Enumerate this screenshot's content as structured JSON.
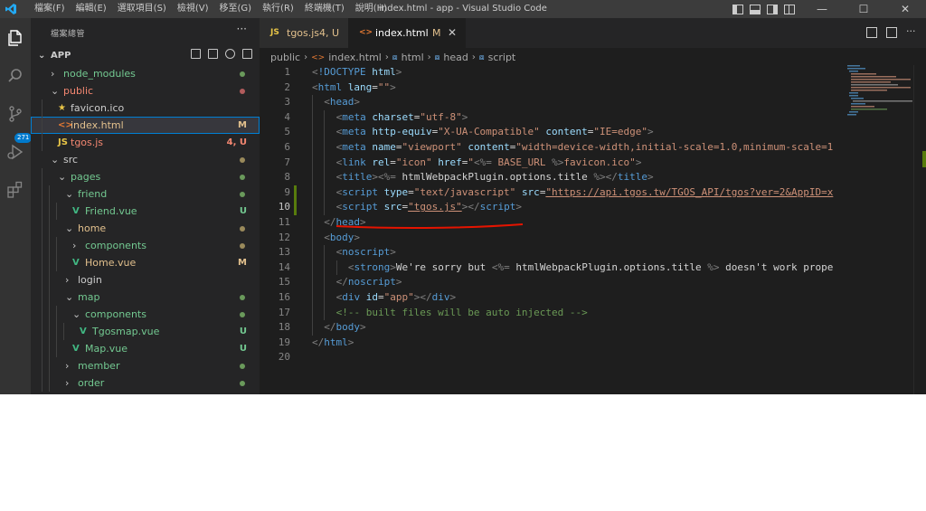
{
  "titlebar": {
    "menus": [
      "檔案(F)",
      "編輯(E)",
      "選取項目(S)",
      "檢視(V)",
      "移至(G)",
      "執行(R)",
      "終端機(T)",
      "說明(H)"
    ],
    "title": "index.html - app - Visual Studio Code",
    "minimize": "—",
    "maximize": "☐",
    "close": "✕"
  },
  "activity": {
    "badge": "271"
  },
  "sidebar": {
    "title": "檔案總管",
    "more": "···",
    "root": "APP",
    "rows": [
      {
        "depth": 0,
        "chev": "›",
        "name": "node_modules",
        "color": "#73c991",
        "status": "dot",
        "statusColor": "#6a9a5b"
      },
      {
        "depth": 0,
        "chev": "⌄",
        "name": "public",
        "color": "#f48771",
        "status": "dot",
        "statusColor": "#b25c5c"
      },
      {
        "depth": 1,
        "icon": "★",
        "iconColor": "#e8c547",
        "name": "favicon.ico",
        "color": "#cccccc",
        "status": "",
        "statusColor": ""
      },
      {
        "depth": 1,
        "icon": "<>",
        "iconColor": "#e37933",
        "name": "index.html",
        "color": "#e2c08d",
        "status": "M",
        "statusColor": "#e2c08d",
        "selected": true
      },
      {
        "depth": 1,
        "icon": "JS",
        "iconColor": "#e8c547",
        "name": "tgos.js",
        "color": "#f48771",
        "status": "4, U",
        "statusColor": "#f48771"
      },
      {
        "depth": 0,
        "chev": "⌄",
        "name": "src",
        "color": "#cccccc",
        "status": "dot",
        "statusColor": "#9a8a5b"
      },
      {
        "depth": 1,
        "chev": "⌄",
        "name": "pages",
        "color": "#73c991",
        "status": "dot",
        "statusColor": "#6a9a5b"
      },
      {
        "depth": 2,
        "chev": "⌄",
        "name": "friend",
        "color": "#73c991",
        "status": "dot",
        "statusColor": "#6a9a5b"
      },
      {
        "depth": 3,
        "icon": "V",
        "iconColor": "#41b883",
        "name": "Friend.vue",
        "color": "#73c991",
        "status": "U",
        "statusColor": "#73c991"
      },
      {
        "depth": 2,
        "chev": "⌄",
        "name": "home",
        "color": "#e2c08d",
        "status": "dot",
        "statusColor": "#9a8a5b"
      },
      {
        "depth": 3,
        "chev": "›",
        "name": "components",
        "color": "#73c991",
        "status": "dot",
        "statusColor": "#9a8a5b"
      },
      {
        "depth": 3,
        "icon": "V",
        "iconColor": "#41b883",
        "name": "Home.vue",
        "color": "#e2c08d",
        "status": "M",
        "statusColor": "#e2c08d"
      },
      {
        "depth": 2,
        "chev": "›",
        "name": "login",
        "color": "#cccccc",
        "status": "",
        "statusColor": ""
      },
      {
        "depth": 2,
        "chev": "⌄",
        "name": "map",
        "color": "#73c991",
        "status": "dot",
        "statusColor": "#6a9a5b"
      },
      {
        "depth": 3,
        "chev": "⌄",
        "name": "components",
        "color": "#73c991",
        "status": "dot",
        "statusColor": "#6a9a5b"
      },
      {
        "depth": 4,
        "icon": "V",
        "iconColor": "#41b883",
        "name": "Tgosmap.vue",
        "color": "#73c991",
        "status": "U",
        "statusColor": "#73c991"
      },
      {
        "depth": 3,
        "icon": "V",
        "iconColor": "#41b883",
        "name": "Map.vue",
        "color": "#73c991",
        "status": "U",
        "statusColor": "#73c991"
      },
      {
        "depth": 2,
        "chev": "›",
        "name": "member",
        "color": "#73c991",
        "status": "dot",
        "statusColor": "#6a9a5b"
      },
      {
        "depth": 2,
        "chev": "›",
        "name": "order",
        "color": "#73c991",
        "status": "dot",
        "statusColor": "#6a9a5b"
      }
    ]
  },
  "tabs": [
    {
      "icon": "JS",
      "name": "tgos.js",
      "modifier": "4, U",
      "close": "",
      "active": false
    },
    {
      "icon": "<>",
      "name": "index.html",
      "modifier": "M",
      "close": "✕",
      "active": true
    }
  ],
  "breadcrumb": [
    "public",
    "index.html",
    "html",
    "head",
    "script"
  ],
  "code": {
    "lines": [
      {
        "n": "1",
        "indent": 0,
        "tokens": [
          [
            "p",
            "<"
          ],
          [
            "t",
            "!DOCTYPE"
          ],
          [
            "x",
            " "
          ],
          [
            "a",
            "html"
          ],
          [
            "p",
            ">"
          ]
        ]
      },
      {
        "n": "2",
        "indent": 0,
        "tokens": [
          [
            "p",
            "<"
          ],
          [
            "t",
            "html"
          ],
          [
            "x",
            " "
          ],
          [
            "a",
            "lang"
          ],
          [
            "x",
            "="
          ],
          [
            "s",
            "\"\""
          ],
          [
            "p",
            ">"
          ]
        ]
      },
      {
        "n": "3",
        "indent": 1,
        "tokens": [
          [
            "p",
            "<"
          ],
          [
            "t",
            "head"
          ],
          [
            "p",
            ">"
          ]
        ]
      },
      {
        "n": "4",
        "indent": 2,
        "tokens": [
          [
            "p",
            "<"
          ],
          [
            "t",
            "meta"
          ],
          [
            "x",
            " "
          ],
          [
            "a",
            "charset"
          ],
          [
            "x",
            "="
          ],
          [
            "s",
            "\"utf-8\""
          ],
          [
            "p",
            ">"
          ]
        ]
      },
      {
        "n": "5",
        "indent": 2,
        "tokens": [
          [
            "p",
            "<"
          ],
          [
            "t",
            "meta"
          ],
          [
            "x",
            " "
          ],
          [
            "a",
            "http-equiv"
          ],
          [
            "x",
            "="
          ],
          [
            "s",
            "\"X-UA-Compatible\""
          ],
          [
            "x",
            " "
          ],
          [
            "a",
            "content"
          ],
          [
            "x",
            "="
          ],
          [
            "s",
            "\"IE=edge\""
          ],
          [
            "p",
            ">"
          ]
        ]
      },
      {
        "n": "6",
        "indent": 2,
        "tokens": [
          [
            "p",
            "<"
          ],
          [
            "t",
            "meta"
          ],
          [
            "x",
            " "
          ],
          [
            "a",
            "name"
          ],
          [
            "x",
            "="
          ],
          [
            "s",
            "\"viewport\""
          ],
          [
            "x",
            " "
          ],
          [
            "a",
            "content"
          ],
          [
            "x",
            "="
          ],
          [
            "s",
            "\"width=device-width,initial-scale=1.0,minimum-scale=1"
          ]
        ]
      },
      {
        "n": "7",
        "indent": 2,
        "tokens": [
          [
            "p",
            "<"
          ],
          [
            "t",
            "link"
          ],
          [
            "x",
            " "
          ],
          [
            "a",
            "rel"
          ],
          [
            "x",
            "="
          ],
          [
            "s",
            "\"icon\""
          ],
          [
            "x",
            " "
          ],
          [
            "a",
            "href"
          ],
          [
            "x",
            "="
          ],
          [
            "s",
            "\""
          ],
          [
            "p",
            "<%="
          ],
          [
            "s",
            " BASE_URL "
          ],
          [
            "p",
            "%>"
          ],
          [
            "s",
            "favicon.ico\""
          ],
          [
            "p",
            ">"
          ]
        ]
      },
      {
        "n": "8",
        "indent": 2,
        "tokens": [
          [
            "p",
            "<"
          ],
          [
            "t",
            "title"
          ],
          [
            "p",
            ">"
          ],
          [
            "p",
            "<%="
          ],
          [
            "x",
            " htmlWebpackPlugin.options.title "
          ],
          [
            "p",
            "%>"
          ],
          [
            "p",
            "</"
          ],
          [
            "t",
            "title"
          ],
          [
            "p",
            ">"
          ]
        ]
      },
      {
        "n": "9",
        "indent": 2,
        "gutter": true,
        "tokens": [
          [
            "p",
            "<"
          ],
          [
            "t",
            "script"
          ],
          [
            "x",
            " "
          ],
          [
            "a",
            "type"
          ],
          [
            "x",
            "="
          ],
          [
            "s",
            "\"text/javascript\""
          ],
          [
            "x",
            " "
          ],
          [
            "a",
            "src"
          ],
          [
            "x",
            "="
          ],
          [
            "su",
            "\"https://api.tgos.tw/TGOS_API/tgos?ver=2&AppID=x"
          ]
        ]
      },
      {
        "n": "10",
        "indent": 2,
        "gutter": true,
        "current": true,
        "tokens": [
          [
            "p",
            "<"
          ],
          [
            "t",
            "script"
          ],
          [
            "x",
            " "
          ],
          [
            "a",
            "src"
          ],
          [
            "x",
            "="
          ],
          [
            "su",
            "\"tgos.js\""
          ],
          [
            "p",
            ">"
          ],
          [
            "p",
            "</"
          ],
          [
            "t",
            "script"
          ],
          [
            "p",
            ">"
          ]
        ]
      },
      {
        "n": "11",
        "indent": 1,
        "tokens": [
          [
            "p",
            "</"
          ],
          [
            "t",
            "head"
          ],
          [
            "p",
            ">"
          ]
        ]
      },
      {
        "n": "12",
        "indent": 1,
        "tokens": [
          [
            "p",
            "<"
          ],
          [
            "t",
            "body"
          ],
          [
            "p",
            ">"
          ]
        ]
      },
      {
        "n": "13",
        "indent": 2,
        "tokens": [
          [
            "p",
            "<"
          ],
          [
            "t",
            "noscript"
          ],
          [
            "p",
            ">"
          ]
        ]
      },
      {
        "n": "14",
        "indent": 3,
        "tokens": [
          [
            "p",
            "<"
          ],
          [
            "t",
            "strong"
          ],
          [
            "p",
            ">"
          ],
          [
            "x",
            "We're sorry but "
          ],
          [
            "p",
            "<%="
          ],
          [
            "x",
            " htmlWebpackPlugin.options.title "
          ],
          [
            "p",
            "%>"
          ],
          [
            "x",
            " doesn't work prope"
          ]
        ]
      },
      {
        "n": "15",
        "indent": 2,
        "tokens": [
          [
            "p",
            "</"
          ],
          [
            "t",
            "noscript"
          ],
          [
            "p",
            ">"
          ]
        ]
      },
      {
        "n": "16",
        "indent": 2,
        "tokens": [
          [
            "p",
            "<"
          ],
          [
            "t",
            "div"
          ],
          [
            "x",
            " "
          ],
          [
            "a",
            "id"
          ],
          [
            "x",
            "="
          ],
          [
            "s",
            "\"app\""
          ],
          [
            "p",
            ">"
          ],
          [
            "p",
            "</"
          ],
          [
            "t",
            "div"
          ],
          [
            "p",
            ">"
          ]
        ]
      },
      {
        "n": "17",
        "indent": 2,
        "tokens": [
          [
            "c",
            "<!-- built files will be auto injected -->"
          ]
        ]
      },
      {
        "n": "18",
        "indent": 1,
        "tokens": [
          [
            "p",
            "</"
          ],
          [
            "t",
            "body"
          ],
          [
            "p",
            ">"
          ]
        ]
      },
      {
        "n": "19",
        "indent": 0,
        "tokens": [
          [
            "p",
            "</"
          ],
          [
            "t",
            "html"
          ],
          [
            "p",
            ">"
          ]
        ]
      },
      {
        "n": "20",
        "indent": 0,
        "tokens": []
      }
    ]
  },
  "colors": {
    "accent": "#007acc",
    "annotation_underline": "#e51400"
  }
}
